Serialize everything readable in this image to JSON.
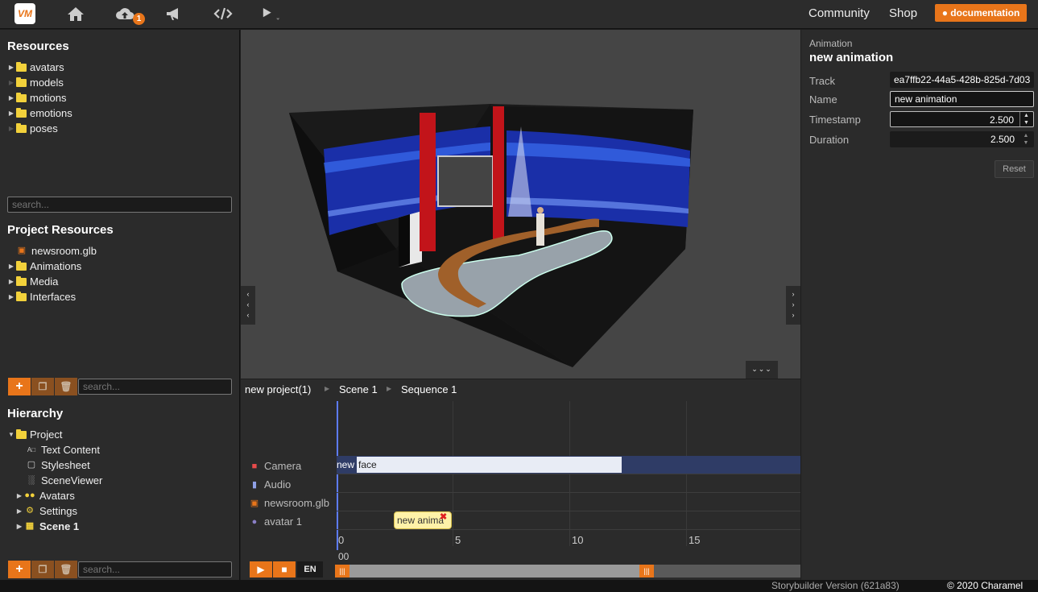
{
  "topbar": {
    "logo": "VM",
    "upload_badge": "1",
    "community": "Community",
    "shop": "Shop",
    "documentation": "documentation"
  },
  "resources": {
    "title": "Resources",
    "items": [
      "avatars",
      "models",
      "motions",
      "emotions",
      "poses"
    ],
    "search_placeholder": "search..."
  },
  "project_resources": {
    "title": "Project Resources",
    "items": [
      "newsroom.glb",
      "Animations",
      "Media",
      "Interfaces"
    ],
    "search_placeholder": "search..."
  },
  "hierarchy": {
    "title": "Hierarchy",
    "items": [
      "Project",
      "Text Content",
      "Stylesheet",
      "SceneViewer",
      "Avatars",
      "Settings",
      "Scene 1"
    ],
    "search_placeholder": "search..."
  },
  "timeline": {
    "breadcrumb": [
      "new project(1)",
      "Scene 1",
      "Sequence 1"
    ],
    "tracks": [
      "Camera",
      "Audio",
      "newsroom.glb",
      "avatar 1"
    ],
    "camera_clip_left": "new",
    "camera_clip_main": "face",
    "avatar_clip": "new anima",
    "ticks": [
      "0",
      "5",
      "10",
      "15"
    ],
    "time_readout": "00",
    "lang": "EN"
  },
  "properties": {
    "section": "Animation",
    "heading": "new animation",
    "track_label": "Track",
    "track_value": "ea7ffb22-44a5-428b-825d-7d03",
    "name_label": "Name",
    "name_value": "new animation",
    "timestamp_label": "Timestamp",
    "timestamp_value": "2.500",
    "duration_label": "Duration",
    "duration_value": "2.500",
    "reset": "Reset"
  },
  "status": {
    "version": "Storybuilder Version (621a83)",
    "copyright": "© 2020 Charamel"
  },
  "colors": {
    "accent": "#e8751a",
    "folder": "#f2d13b"
  }
}
